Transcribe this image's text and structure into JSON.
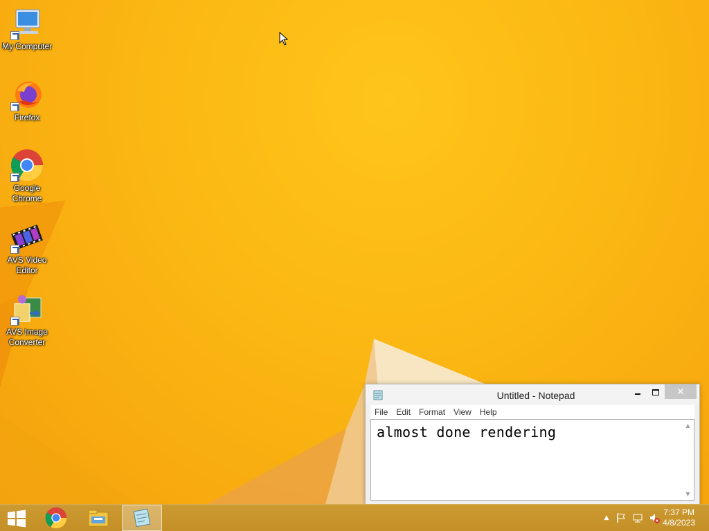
{
  "desktop": {
    "icons": [
      {
        "label": "My Computer",
        "icon": "computer-icon"
      },
      {
        "label": "Firefox",
        "icon": "firefox-icon"
      },
      {
        "label": "Google\nChrome",
        "icon": "chrome-icon"
      },
      {
        "label": "AVS Video\nEditor",
        "icon": "film-icon"
      },
      {
        "label": "AVS Image\nConverter",
        "icon": "image-converter-icon"
      }
    ]
  },
  "notepad": {
    "title": "Untitled - Notepad",
    "menu": [
      "File",
      "Edit",
      "Format",
      "View",
      "Help"
    ],
    "content": "almost done rendering",
    "close_glyph": "✕"
  },
  "taskbar": {
    "items": [
      "start-icon",
      "chrome-icon",
      "file-explorer-icon",
      "notepad-icon"
    ],
    "tray_up_glyph": "▲",
    "clock": {
      "time": "7:37 PM",
      "date": "4/8/2023"
    }
  },
  "colors": {
    "desktop_bg": "#f6b40a",
    "taskbar": "#c8952c",
    "close_button": "#c7c7c7"
  }
}
